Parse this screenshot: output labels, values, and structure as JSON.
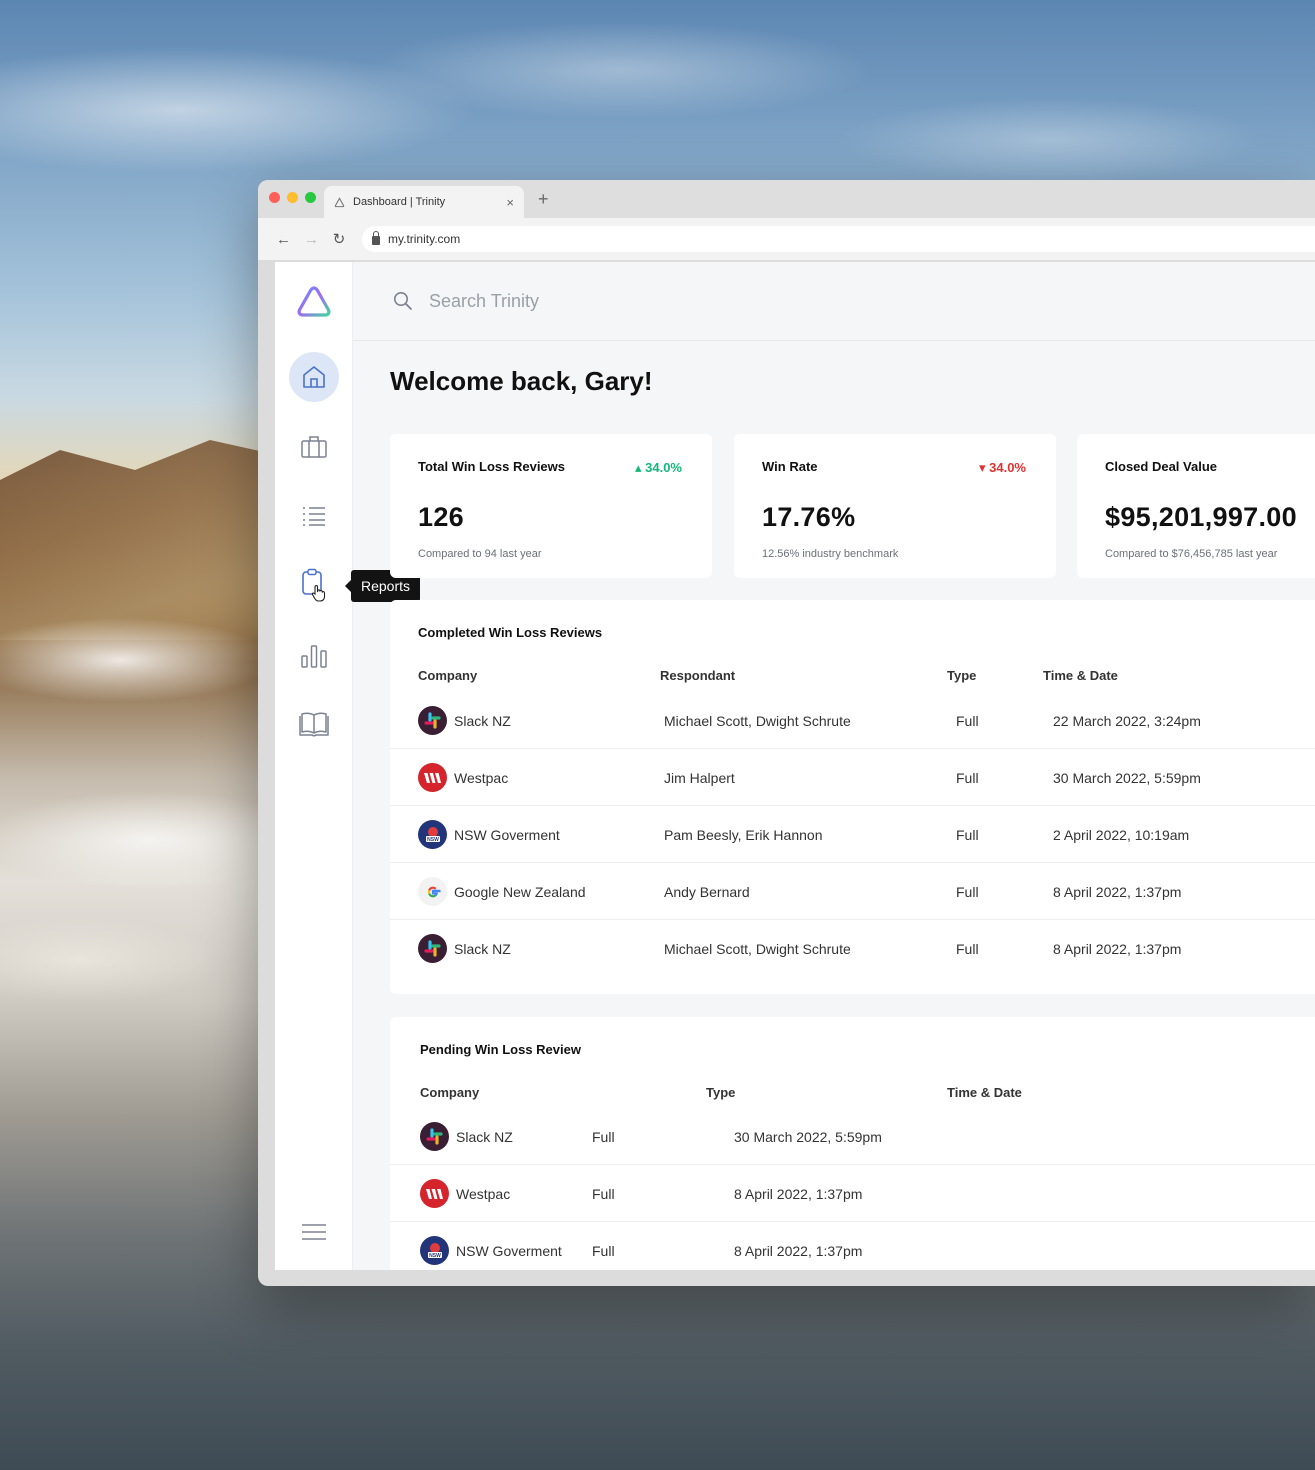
{
  "browser": {
    "tab_title": "Dashboard | Trinity",
    "url": "my.trinity.com"
  },
  "sidebar": {
    "items": [
      {
        "name": "home",
        "icon": "home-icon",
        "active": true
      },
      {
        "name": "briefcase",
        "icon": "briefcase-icon"
      },
      {
        "name": "list",
        "icon": "list-icon"
      },
      {
        "name": "reports",
        "icon": "clipboard-icon"
      },
      {
        "name": "analytics",
        "icon": "bar-chart-icon"
      },
      {
        "name": "library",
        "icon": "book-icon"
      }
    ],
    "tooltip": "Reports"
  },
  "search": {
    "placeholder": "Search Trinity"
  },
  "welcome": "Welcome back, Gary!",
  "stats": [
    {
      "title": "Total Win Loss Reviews",
      "delta": "34.0%",
      "direction": "up",
      "value": "126",
      "sub": "Compared to 94 last year"
    },
    {
      "title": "Win Rate",
      "delta": "34.0%",
      "direction": "down",
      "value": "17.76%",
      "sub": "12.56% industry benchmark"
    },
    {
      "title": "Closed Deal Value",
      "delta": "",
      "direction": "",
      "value": "$95,201,997.00",
      "sub": "Compared to $76,456,785 last year"
    }
  ],
  "completed": {
    "title": "Completed Win Loss Reviews",
    "headers": {
      "company": "Company",
      "respondant": "Respondant",
      "type": "Type",
      "time": "Time & Date"
    },
    "rows": [
      {
        "company": "Slack NZ",
        "logo": "slack",
        "respondant": "Michael Scott, Dwight Schrute",
        "type": "Full",
        "time": "22 March 2022, 3:24pm"
      },
      {
        "company": "Westpac",
        "logo": "westpac",
        "respondant": "Jim Halpert",
        "type": "Full",
        "time": "30 March 2022, 5:59pm"
      },
      {
        "company": "NSW Goverment",
        "logo": "nsw",
        "respondant": "Pam Beesly, Erik Hannon",
        "type": "Full",
        "time": "2 April 2022, 10:19am"
      },
      {
        "company": "Google New Zealand",
        "logo": "google",
        "respondant": "Andy Bernard",
        "type": "Full",
        "time": "8 April 2022, 1:37pm"
      },
      {
        "company": "Slack NZ",
        "logo": "slack",
        "respondant": "Michael Scott, Dwight Schrute",
        "type": "Full",
        "time": "8 April 2022, 1:37pm"
      }
    ]
  },
  "pending": {
    "title": "Pending Win Loss Review",
    "headers": {
      "company": "Company",
      "type": "Type",
      "time": "Time & Date"
    },
    "rows": [
      {
        "company": "Slack NZ",
        "logo": "slack",
        "type": "Full",
        "time": "30 March 2022, 5:59pm"
      },
      {
        "company": "Westpac",
        "logo": "westpac",
        "type": "Full",
        "time": "8 April 2022, 1:37pm"
      },
      {
        "company": "NSW Goverment",
        "logo": "nsw",
        "type": "Full",
        "time": "8 April 2022, 1:37pm"
      }
    ]
  },
  "colors": {
    "accent": "#4a72c9",
    "up": "#14b87a",
    "down": "#e03131",
    "active_bg": "#dde6f7"
  }
}
